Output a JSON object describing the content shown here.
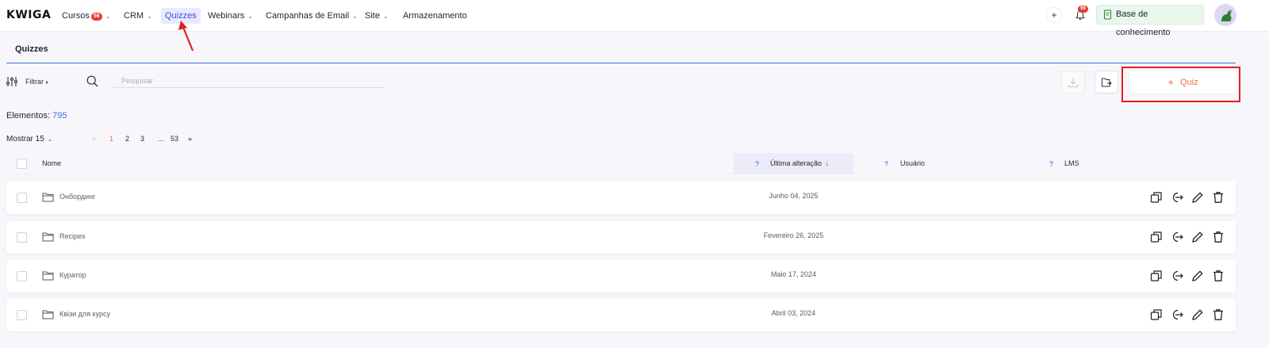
{
  "app": {
    "logo": "KWIGA"
  },
  "nav": {
    "courses": "Cursos",
    "courses_badge": "56",
    "crm": "CRM",
    "quizzes": "Quizzes",
    "webinars": "Webinars",
    "email": "Campanhas de Email",
    "site": "Site",
    "storage": "Armazenamento",
    "notif_badge": "99",
    "add_label": "+",
    "knowledge_base": "Base de conhecimento"
  },
  "page": {
    "tab_title": "Quizzes"
  },
  "toolbar": {
    "filter_label": "Filtrar",
    "search_placeholder": "Pesquisar",
    "add_button_label": "Quiz"
  },
  "summary": {
    "elements_label": "Elementos:",
    "elements_count": "795",
    "show_label": "Mostrar 15"
  },
  "pagination": {
    "prev": "«",
    "p1": "1",
    "p2": "2",
    "p3": "3",
    "ellipsis": "...",
    "last": "53",
    "next": "»"
  },
  "table": {
    "headers": {
      "name": "Nome",
      "help": "?",
      "last_modified": "Última alteração",
      "sort_arrow": "↓",
      "user": "Usuário",
      "lms": "LMS"
    },
    "rows": [
      {
        "name": "Онбординг",
        "date": "Junho 04, 2025"
      },
      {
        "name": "Recipes",
        "date": "Fevereiro 26, 2025"
      },
      {
        "name": "Куратор",
        "date": "Maio 17, 2024"
      },
      {
        "name": "Квізи для курсу",
        "date": "Abril 03, 2024"
      }
    ]
  },
  "colors": {
    "accent": "#3b4ce6",
    "brand_orange": "#f26b3a",
    "highlight_red": "#e02020"
  },
  "icons": [
    "filter-icon",
    "search-icon",
    "download-icon",
    "export-icon",
    "folder-icon",
    "copy-icon",
    "move-icon",
    "edit-icon",
    "trash-icon",
    "bell-icon",
    "book-icon"
  ]
}
